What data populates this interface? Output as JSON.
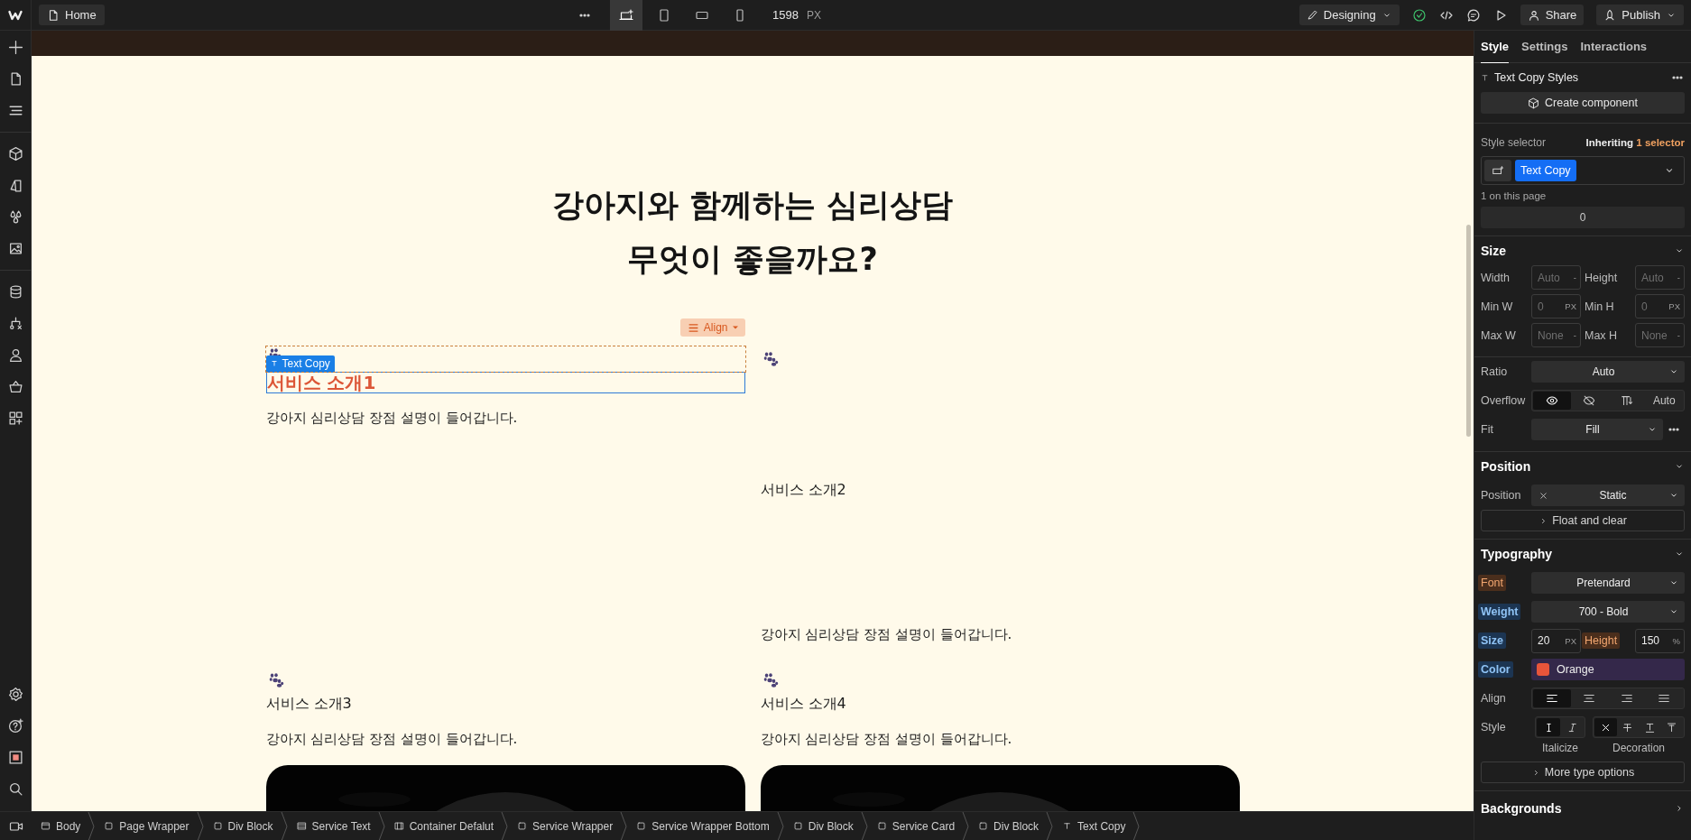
{
  "topbar": {
    "page": "Home",
    "breakpoints": [
      {
        "kind": "desktop",
        "selected": true
      },
      {
        "kind": "tablet",
        "selected": false
      },
      {
        "kind": "landscape",
        "selected": false
      },
      {
        "kind": "portrait",
        "selected": false
      }
    ],
    "width_value": "1598",
    "width_unit": "PX",
    "mode": "Designing",
    "share": "Share",
    "publish": "Publish"
  },
  "canvas": {
    "heading_lines": [
      "강아지와 함께하는 심리상담",
      "무엇이 좋을까요?"
    ],
    "align_button": "Align",
    "selection_tag": "Text Copy",
    "cards": [
      {
        "title": "서비스 소개1",
        "description": "강아지 심리상담 장점 설명이 들어갑니다.",
        "selected": true
      },
      {
        "title": "서비스 소개2",
        "description": "강아지 심리상담 장점 설명이 들어갑니다.",
        "selected": false
      },
      {
        "title": "서비스 소개3",
        "description": "강아지 심리상담 장점 설명이 들어갑니다.",
        "selected": false
      },
      {
        "title": "서비스 소개4",
        "description": "강아지 심리상담 장점 설명이 들어갑니다.",
        "selected": false
      }
    ],
    "image_cards": [
      {
        "kind": "picture"
      },
      {
        "kind": "picture"
      }
    ]
  },
  "breadcrumb": [
    {
      "label": "Body",
      "kind": "body"
    },
    {
      "label": "Page Wrapper",
      "kind": "box"
    },
    {
      "label": "Div Block",
      "kind": "box"
    },
    {
      "label": "Service Text",
      "kind": "section"
    },
    {
      "label": "Container Defalut",
      "kind": "container"
    },
    {
      "label": "Service Wrapper",
      "kind": "box"
    },
    {
      "label": "Service Wrapper Bottom",
      "kind": "box"
    },
    {
      "label": "Div Block",
      "kind": "box"
    },
    {
      "label": "Service Card",
      "kind": "box"
    },
    {
      "label": "Div Block",
      "kind": "box"
    },
    {
      "label": "Text Copy",
      "kind": "text"
    }
  ],
  "panel": {
    "tabs": [
      {
        "label": "Style",
        "selected": true
      },
      {
        "label": "Settings",
        "selected": false
      },
      {
        "label": "Interactions",
        "selected": false
      }
    ],
    "element_styles": "Text Copy Styles",
    "create_component": "Create component",
    "style_selector": {
      "label": "Style selector",
      "inheriting": "Inheriting",
      "inherit_count": "1 selector",
      "chip": "Text Copy",
      "usage": "1 on this page"
    },
    "spacing_value": "0",
    "size": {
      "title": "Size",
      "fields": [
        {
          "label": "Width",
          "placeholder": "Auto",
          "unit": "-"
        },
        {
          "label": "Height",
          "placeholder": "Auto",
          "unit": "-"
        },
        {
          "label": "Min W",
          "placeholder": "0",
          "unit": "PX"
        },
        {
          "label": "Min H",
          "placeholder": "0",
          "unit": "PX"
        },
        {
          "label": "Max W",
          "placeholder": "None",
          "unit": "-"
        },
        {
          "label": "Max H",
          "placeholder": "None",
          "unit": "-"
        }
      ]
    },
    "ratio": {
      "label": "Ratio",
      "value": "Auto"
    },
    "overflow": {
      "label": "Overflow",
      "options": [
        {
          "kind": "visible",
          "selected": true
        },
        {
          "kind": "hidden",
          "selected": false
        },
        {
          "kind": "scroll",
          "selected": false
        },
        {
          "kind": "auto",
          "label": "Auto",
          "selected": false
        }
      ]
    },
    "fit": {
      "label": "Fit",
      "value": "Fill"
    },
    "position": {
      "title": "Position",
      "label": "Position",
      "value": "Static",
      "float_button": "Float and clear"
    },
    "typography": {
      "title": "Typography",
      "font": {
        "label": "Font",
        "inherited": false,
        "value": "Pretendard"
      },
      "weight": {
        "label": "Weight",
        "inherited": true,
        "value": "700 - Bold"
      },
      "size": {
        "label": "Size",
        "inherited": true,
        "value": "20",
        "unit": "PX"
      },
      "line_height": {
        "label": "Height",
        "inherited": false,
        "value": "150",
        "unit": "%"
      },
      "color": {
        "label": "Color",
        "inherited": true,
        "value": "Orange",
        "color": "#e8553a"
      },
      "align": {
        "label": "Align",
        "options": [
          {
            "kind": "left",
            "selected": true
          },
          {
            "kind": "center",
            "selected": false
          },
          {
            "kind": "right",
            "selected": false
          },
          {
            "kind": "justify",
            "selected": false
          }
        ]
      },
      "style": {
        "label": "Style",
        "italicize": {
          "caption": "Italicize",
          "options": [
            {
              "kind": "normal",
              "selected": true
            },
            {
              "kind": "italic",
              "selected": false
            }
          ]
        },
        "decoration": {
          "caption": "Decoration",
          "options": [
            {
              "kind": "none",
              "selected": true
            },
            {
              "kind": "strike",
              "selected": false
            },
            {
              "kind": "underline",
              "selected": false
            },
            {
              "kind": "overline",
              "selected": false
            }
          ]
        }
      },
      "more_button": "More type options"
    },
    "backgrounds": {
      "title": "Backgrounds"
    }
  }
}
